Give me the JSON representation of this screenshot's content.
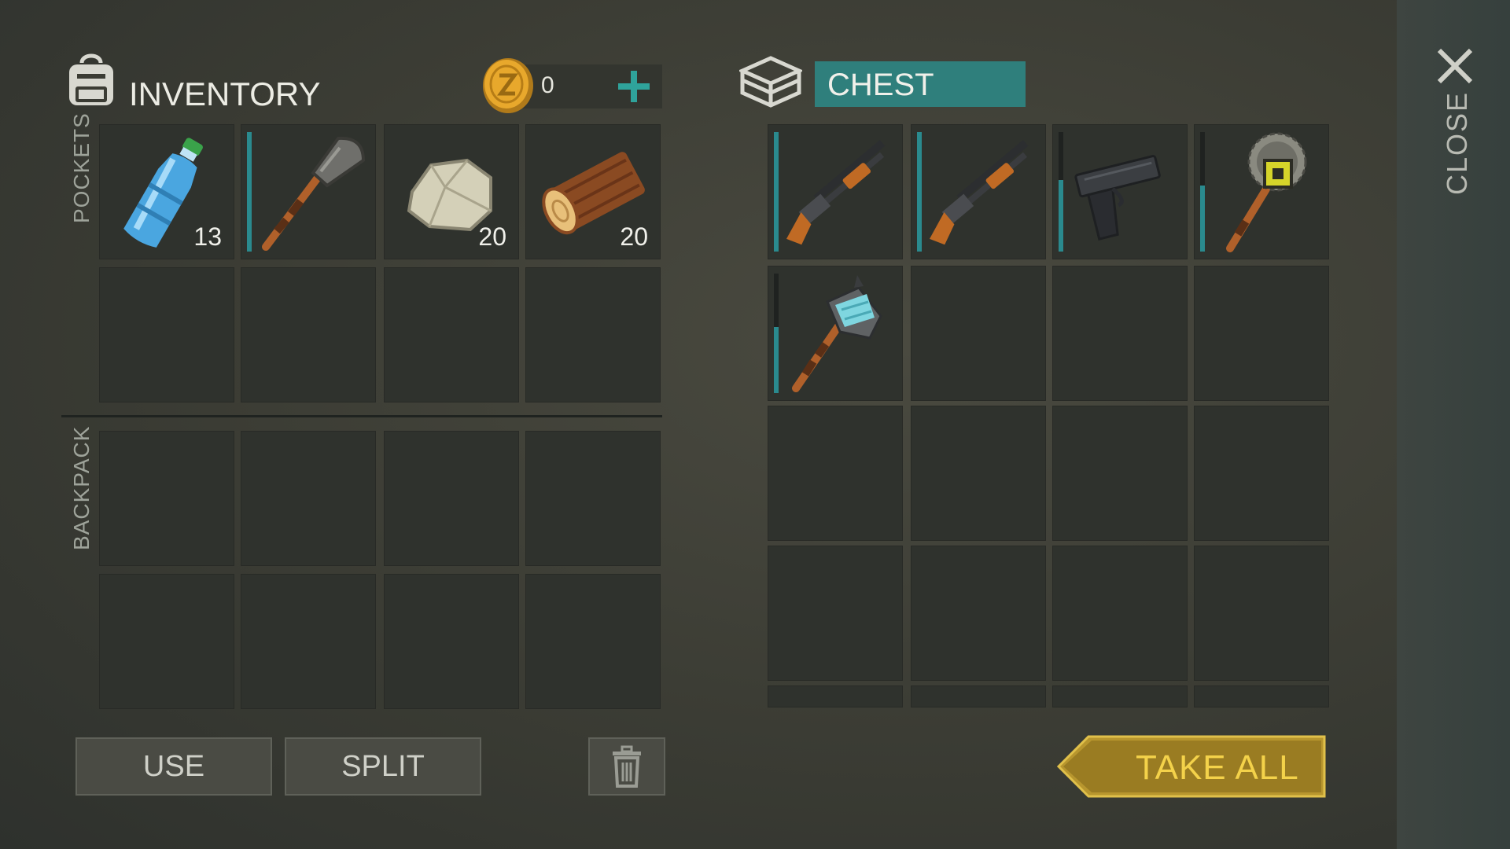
{
  "inventory": {
    "title": "INVENTORY",
    "coins": "0",
    "pockets_label": "POCKETS",
    "backpack_label": "BACKPACK",
    "pocket_slots": [
      {
        "item": "water-bottle",
        "qty": "13"
      },
      {
        "item": "shovel",
        "qty": "",
        "durability": 1.0
      },
      {
        "item": "stone",
        "qty": "20"
      },
      {
        "item": "wood-log",
        "qty": "20"
      }
    ]
  },
  "chest": {
    "title": "CHEST",
    "slots": [
      {
        "item": "pump-shotgun",
        "durability": 1.0
      },
      {
        "item": "pump-shotgun",
        "durability": 1.0
      },
      {
        "item": "pistol",
        "durability": 0.6
      },
      {
        "item": "saw-blade-mace",
        "durability": 0.55
      },
      {
        "item": "stone-hammer",
        "durability": 0.55
      }
    ]
  },
  "buttons": {
    "use": "USE",
    "split": "SPLIT",
    "take_all": "TAKE ALL",
    "close": "CLOSE"
  },
  "colors": {
    "accent_teal": "#2a8a8e",
    "take_all_gold": "#b8962e",
    "take_all_text": "#f4d24a"
  },
  "icons": [
    "backpack-icon",
    "coin-icon",
    "plus-icon",
    "chest-icon",
    "trash-icon",
    "close-icon"
  ]
}
